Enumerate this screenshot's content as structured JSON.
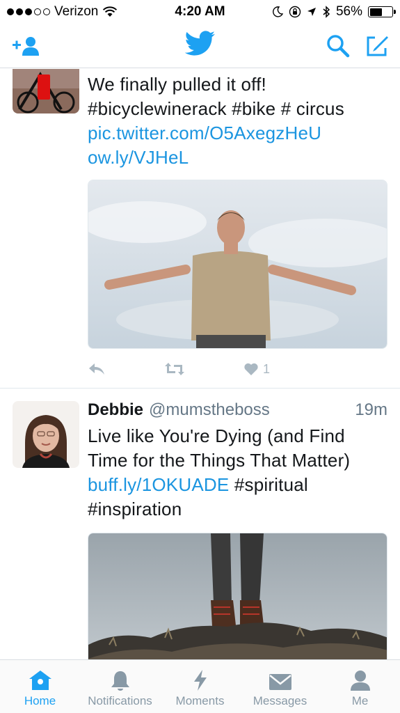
{
  "status": {
    "carrier": "Verizon",
    "time": "4:20 AM",
    "battery": "56%",
    "battery_level": 0.56
  },
  "colors": {
    "accent": "#1da1f2",
    "link": "#1b95e0",
    "muted": "#8899a6"
  },
  "nav": {
    "icons": [
      "add-user-icon",
      "twitter-bird-icon",
      "search-icon",
      "compose-icon"
    ]
  },
  "tweets": [
    {
      "text_line1": "We finally pulled it off!",
      "text_line2": "#bicyclewinerack #bike # circus",
      "link1": "pic.twitter.com/O5AxegzHeU",
      "link2": "ow.ly/VJHeL",
      "likes": "1"
    },
    {
      "name": "Debbie",
      "handle": "@mumstheboss",
      "time": "19m",
      "text_line1": "Live like You're Dying (and Find",
      "text_line2": "Time for the Things That Matter)",
      "link": "buff.ly/1OKUADE",
      "tag1": "#spiritual",
      "tag2": "#inspiration"
    }
  ],
  "tabs": [
    {
      "label": "Home",
      "icon": "home-icon",
      "active": true
    },
    {
      "label": "Notifications",
      "icon": "bell-icon",
      "active": false
    },
    {
      "label": "Moments",
      "icon": "lightning-icon",
      "active": false
    },
    {
      "label": "Messages",
      "icon": "envelope-icon",
      "active": false
    },
    {
      "label": "Me",
      "icon": "person-icon",
      "active": false
    }
  ]
}
